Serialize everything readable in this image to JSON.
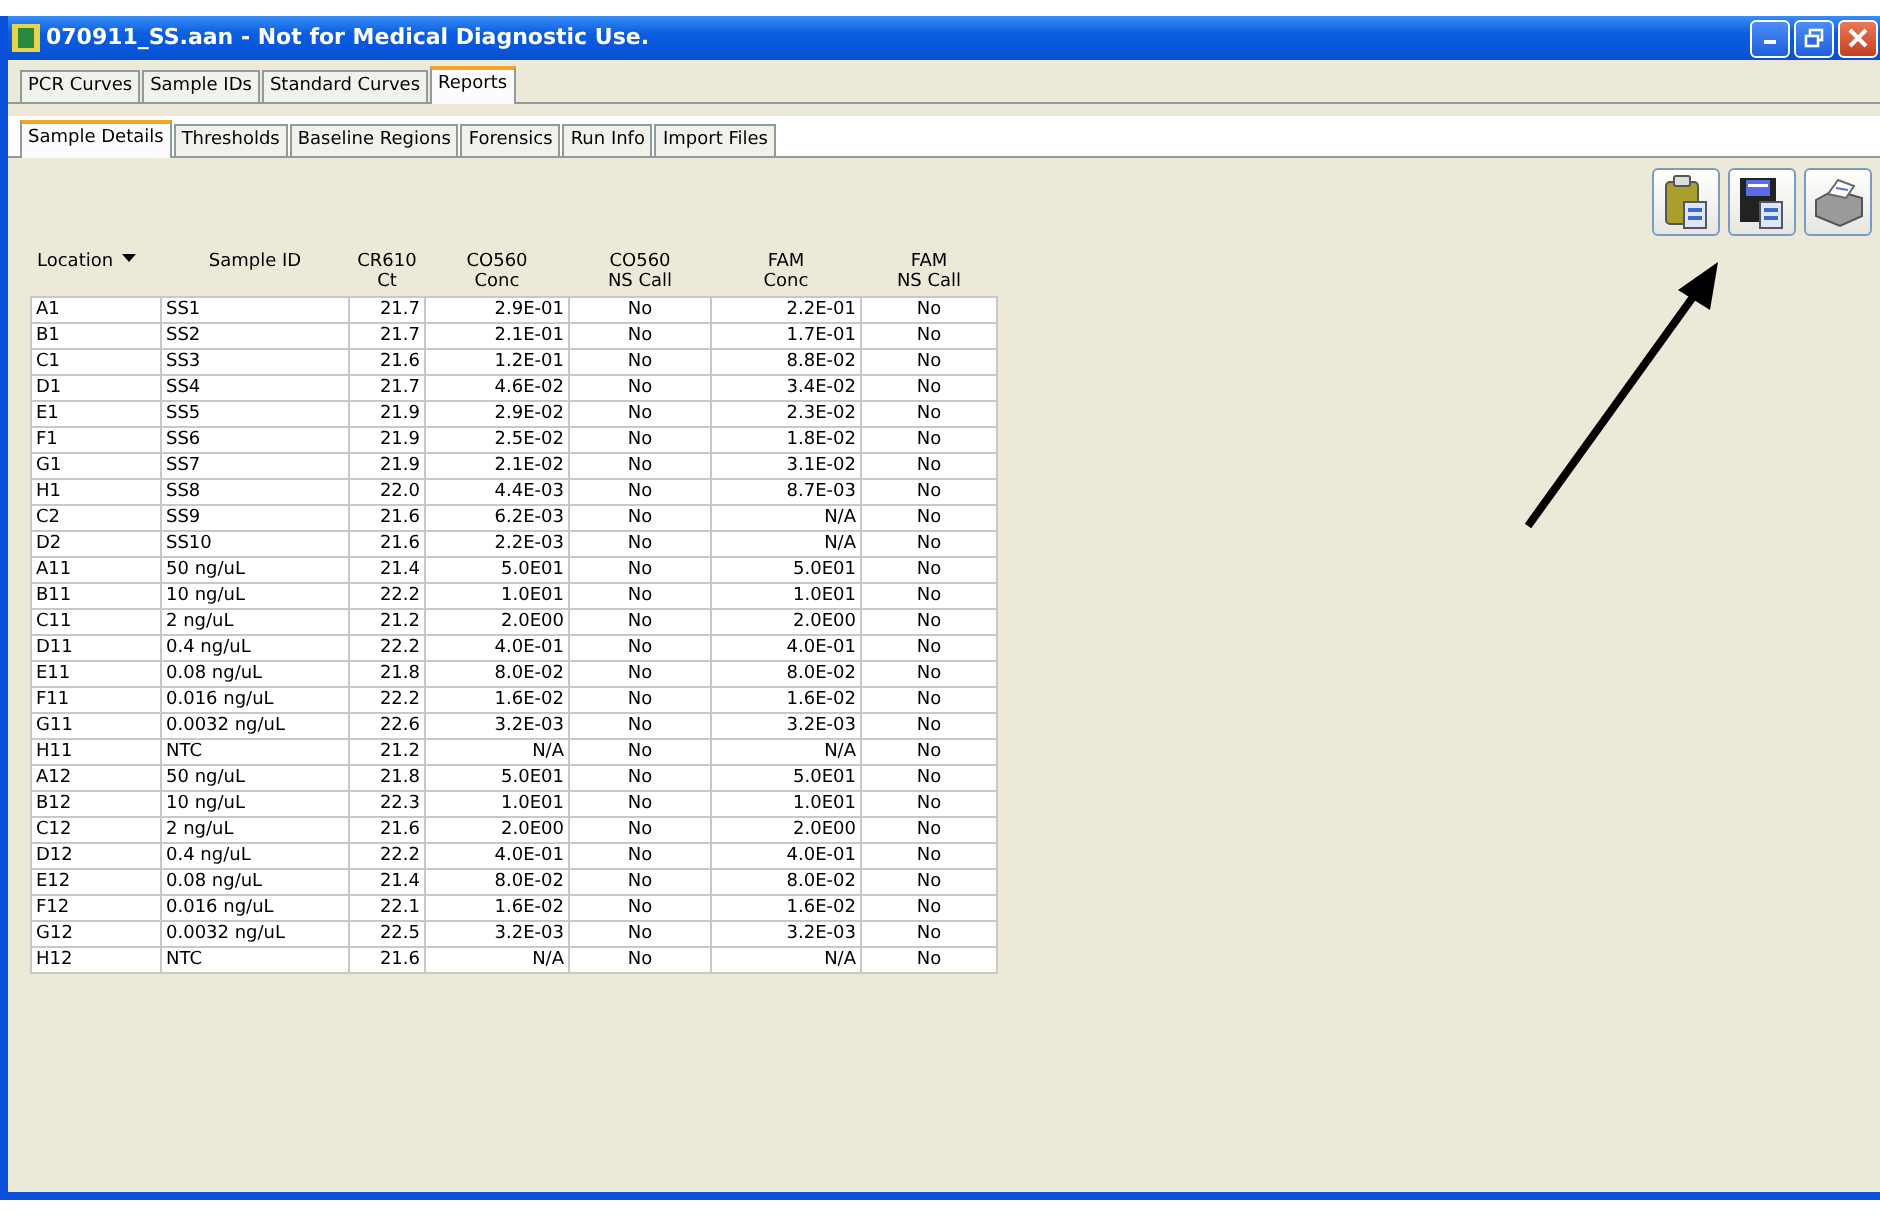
{
  "window": {
    "title": "070911_SS.aan - Not for Medical Diagnostic Use."
  },
  "tabs": [
    {
      "label": "PCR Curves",
      "selected": false
    },
    {
      "label": "Sample IDs",
      "selected": false
    },
    {
      "label": "Standard Curves",
      "selected": false
    },
    {
      "label": "Reports",
      "selected": true
    }
  ],
  "subtabs": [
    {
      "label": "Sample Details",
      "selected": true
    },
    {
      "label": "Thresholds",
      "selected": false
    },
    {
      "label": "Baseline Regions",
      "selected": false
    },
    {
      "label": "Forensics",
      "selected": false
    },
    {
      "label": "Run Info",
      "selected": false
    },
    {
      "label": "Import Files",
      "selected": false
    }
  ],
  "table": {
    "columns": [
      {
        "lines": [
          "Location"
        ],
        "sorted": true
      },
      {
        "lines": [
          "Sample ID"
        ],
        "sorted": false
      },
      {
        "lines": [
          "CR610",
          "Ct"
        ],
        "sorted": false
      },
      {
        "lines": [
          "CO560",
          "Conc"
        ],
        "sorted": false
      },
      {
        "lines": [
          "CO560",
          "NS Call"
        ],
        "sorted": false
      },
      {
        "lines": [
          "FAM",
          "Conc"
        ],
        "sorted": false
      },
      {
        "lines": [
          "FAM",
          "NS Call"
        ],
        "sorted": false
      }
    ],
    "rows": [
      [
        "A1",
        "SS1",
        "21.7",
        "2.9E-01",
        "No",
        "2.2E-01",
        "No"
      ],
      [
        "B1",
        "SS2",
        "21.7",
        "2.1E-01",
        "No",
        "1.7E-01",
        "No"
      ],
      [
        "C1",
        "SS3",
        "21.6",
        "1.2E-01",
        "No",
        "8.8E-02",
        "No"
      ],
      [
        "D1",
        "SS4",
        "21.7",
        "4.6E-02",
        "No",
        "3.4E-02",
        "No"
      ],
      [
        "E1",
        "SS5",
        "21.9",
        "2.9E-02",
        "No",
        "2.3E-02",
        "No"
      ],
      [
        "F1",
        "SS6",
        "21.9",
        "2.5E-02",
        "No",
        "1.8E-02",
        "No"
      ],
      [
        "G1",
        "SS7",
        "21.9",
        "2.1E-02",
        "No",
        "3.1E-02",
        "No"
      ],
      [
        "H1",
        "SS8",
        "22.0",
        "4.4E-03",
        "No",
        "8.7E-03",
        "No"
      ],
      [
        "C2",
        "SS9",
        "21.6",
        "6.2E-03",
        "No",
        "N/A",
        "No"
      ],
      [
        "D2",
        "SS10",
        "21.6",
        "2.2E-03",
        "No",
        "N/A",
        "No"
      ],
      [
        "A11",
        "50 ng/uL",
        "21.4",
        "5.0E01",
        "No",
        "5.0E01",
        "No"
      ],
      [
        "B11",
        "10 ng/uL",
        "22.2",
        "1.0E01",
        "No",
        "1.0E01",
        "No"
      ],
      [
        "C11",
        "2 ng/uL",
        "21.2",
        "2.0E00",
        "No",
        "2.0E00",
        "No"
      ],
      [
        "D11",
        "0.4 ng/uL",
        "22.2",
        "4.0E-01",
        "No",
        "4.0E-01",
        "No"
      ],
      [
        "E11",
        "0.08 ng/uL",
        "21.8",
        "8.0E-02",
        "No",
        "8.0E-02",
        "No"
      ],
      [
        "F11",
        "0.016 ng/uL",
        "22.2",
        "1.6E-02",
        "No",
        "1.6E-02",
        "No"
      ],
      [
        "G11",
        "0.0032 ng/uL",
        "22.6",
        "3.2E-03",
        "No",
        "3.2E-03",
        "No"
      ],
      [
        "H11",
        "NTC",
        "21.2",
        "N/A",
        "No",
        "N/A",
        "No"
      ],
      [
        "A12",
        "50 ng/uL",
        "21.8",
        "5.0E01",
        "No",
        "5.0E01",
        "No"
      ],
      [
        "B12",
        "10 ng/uL",
        "22.3",
        "1.0E01",
        "No",
        "1.0E01",
        "No"
      ],
      [
        "C12",
        "2 ng/uL",
        "21.6",
        "2.0E00",
        "No",
        "2.0E00",
        "No"
      ],
      [
        "D12",
        "0.4 ng/uL",
        "22.2",
        "4.0E-01",
        "No",
        "4.0E-01",
        "No"
      ],
      [
        "E12",
        "0.08 ng/uL",
        "21.4",
        "8.0E-02",
        "No",
        "8.0E-02",
        "No"
      ],
      [
        "F12",
        "0.016 ng/uL",
        "22.1",
        "1.6E-02",
        "No",
        "1.6E-02",
        "No"
      ],
      [
        "G12",
        "0.0032 ng/uL",
        "22.5",
        "3.2E-03",
        "No",
        "3.2E-03",
        "No"
      ],
      [
        "H12",
        "NTC",
        "21.6",
        "N/A",
        "No",
        "N/A",
        "No"
      ]
    ]
  }
}
